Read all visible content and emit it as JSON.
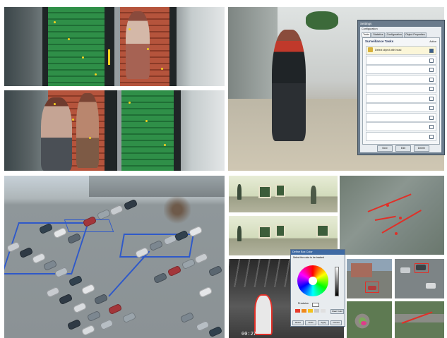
{
  "settings_dialog": {
    "window_title": "Settings",
    "section": "Configuration",
    "tabs": [
      "Tasks",
      "Statistics",
      "Configuration",
      "Object Properties"
    ],
    "heading": "Surveillance Tasks",
    "active_label": "Active",
    "rows": [
      {
        "text": "Detect object with head",
        "checked": true
      },
      {
        "text": "",
        "checked": false
      },
      {
        "text": "",
        "checked": false
      },
      {
        "text": "",
        "checked": false
      },
      {
        "text": "",
        "checked": false
      },
      {
        "text": "",
        "checked": false
      },
      {
        "text": "",
        "checked": false
      },
      {
        "text": "",
        "checked": false
      },
      {
        "text": "",
        "checked": false
      },
      {
        "text": "",
        "checked": false
      }
    ],
    "buttons": [
      "New",
      "Edit",
      "Delete"
    ]
  },
  "color_dialog": {
    "title": "Define Box Color",
    "subtitle": "Select the color to be tracked",
    "label": "Precision",
    "buttons": [
      "Reset",
      "Undo",
      "Apply",
      "Cancel"
    ],
    "swatch_colors": [
      "#e83b2c",
      "#f08a1c",
      "#f2c21d",
      "#c9c9c9",
      "#e0e0e0"
    ],
    "side_button": "Clear Color"
  },
  "thermal_timestamp": "00:27",
  "colors": {
    "zone_blue": "#2f59c9",
    "marker_yellow": "#f4d11f",
    "track_red": "#e03028"
  }
}
